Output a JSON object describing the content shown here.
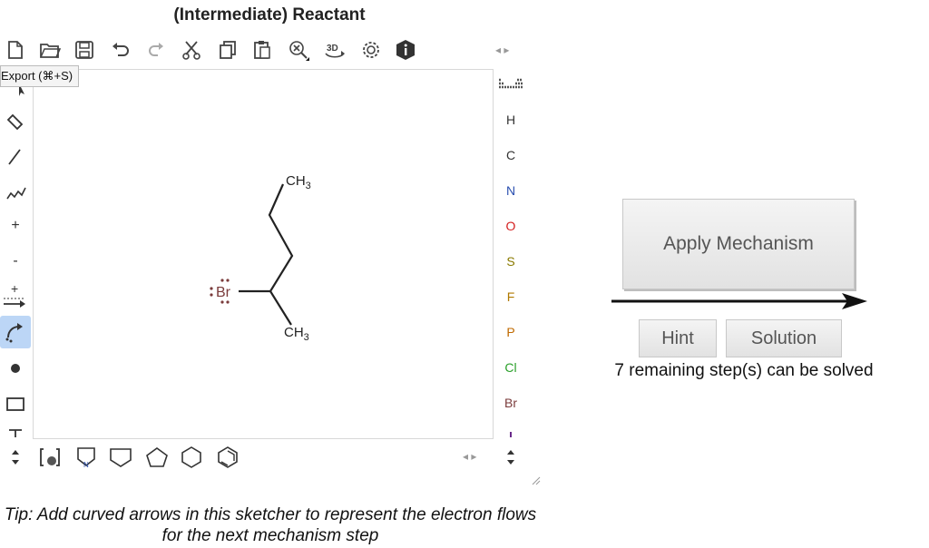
{
  "title": "(Intermediate) Reactant",
  "tooltip": "Export (⌘+S)",
  "toolbar": {
    "icons": [
      "new-icon",
      "open-icon",
      "save-icon",
      "undo-icon",
      "redo-icon",
      "cut-icon",
      "copy-icon",
      "paste-icon",
      "zoom-clear-icon",
      "3d-icon",
      "settings-icon",
      "info-icon"
    ],
    "scroll_arrows": "◂ ▸"
  },
  "left_tools": [
    "select-tool",
    "erase-tool",
    "bond-tool",
    "chain-tool",
    "charge-plus-tool",
    "charge-minus-tool",
    "reaction-arrow-tool",
    "curved-arrow-tool",
    "radical-tool",
    "rectangle-tool",
    "text-tool"
  ],
  "left_labels": {
    "charge_plus": "+",
    "charge_minus": "-"
  },
  "elements": [
    {
      "symbol": "H",
      "color": "#333333"
    },
    {
      "symbol": "C",
      "color": "#333333"
    },
    {
      "symbol": "N",
      "color": "#2a4fb0"
    },
    {
      "symbol": "O",
      "color": "#d42020"
    },
    {
      "symbol": "S",
      "color": "#8a7a00"
    },
    {
      "symbol": "F",
      "color": "#b07a00"
    },
    {
      "symbol": "P",
      "color": "#c06a00"
    },
    {
      "symbol": "Cl",
      "color": "#2aa02a"
    },
    {
      "symbol": "Br",
      "color": "#7a3b3b"
    }
  ],
  "bottom_toolbar": {
    "shapes": [
      "template-icon",
      "cyclopropane-icon",
      "cyclobutane-icon",
      "cyclopentane-icon",
      "cyclohexane-icon",
      "benzene-icon"
    ],
    "scroll_arrows": "◂ ▸"
  },
  "molecule": {
    "atoms": {
      "top_methyl": "CH3",
      "bottom_methyl": "CH3",
      "halogen": "Br"
    }
  },
  "tip": "Tip: Add curved arrows in this sketcher to represent the electron flows for the next mechanism step",
  "buttons": {
    "apply": "Apply Mechanism",
    "hint": "Hint",
    "solution": "Solution"
  },
  "status": "7 remaining step(s) can be solved"
}
